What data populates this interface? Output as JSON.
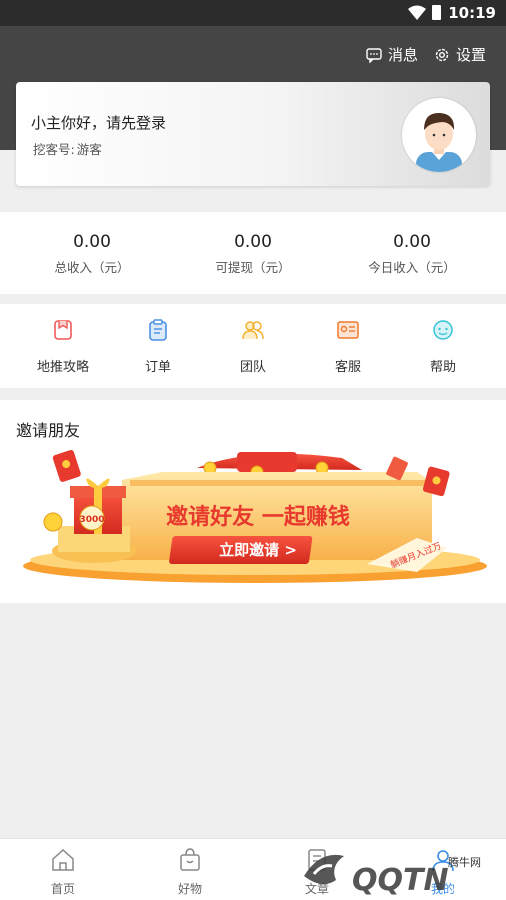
{
  "status_bar": {
    "time": "10:19"
  },
  "header": {
    "messages_label": "消息",
    "settings_label": "设置"
  },
  "user_card": {
    "greeting": "小主你好，请先登录",
    "visitor_label": "挖客号:",
    "visitor_value": "游客"
  },
  "stats": [
    {
      "value": "0.00",
      "label": "总收入（元）"
    },
    {
      "value": "0.00",
      "label": "可提现（元）"
    },
    {
      "value": "0.00",
      "label": "今日收入（元）"
    }
  ],
  "menu": [
    {
      "label": "地推攻略",
      "icon": "strategy-icon",
      "color": "#ef5a5a"
    },
    {
      "label": "订单",
      "icon": "order-icon",
      "color": "#4a90e2"
    },
    {
      "label": "团队",
      "icon": "team-icon",
      "color": "#f2b233"
    },
    {
      "label": "客服",
      "icon": "service-icon",
      "color": "#f07a2e"
    },
    {
      "label": "帮助",
      "icon": "help-icon",
      "color": "#34c3d6"
    }
  ],
  "invite": {
    "title": "邀请朋友",
    "banner_headline": "邀请好友 一起赚钱",
    "banner_button": "立即邀请 >",
    "banner_badge": "3000",
    "banner_tag": "躺赚月入过万"
  },
  "tabbar": [
    {
      "label": "首页",
      "icon": "home-icon"
    },
    {
      "label": "好物",
      "icon": "shopping-bag-icon"
    },
    {
      "label": "文章",
      "icon": "article-icon"
    },
    {
      "label": "我的",
      "icon": "profile-icon"
    }
  ],
  "watermark": {
    "text": "腾牛网"
  },
  "colors": {
    "header_bg": "#454545",
    "accent_red": "#e8392e",
    "banner_orange": "#f7a23a"
  }
}
